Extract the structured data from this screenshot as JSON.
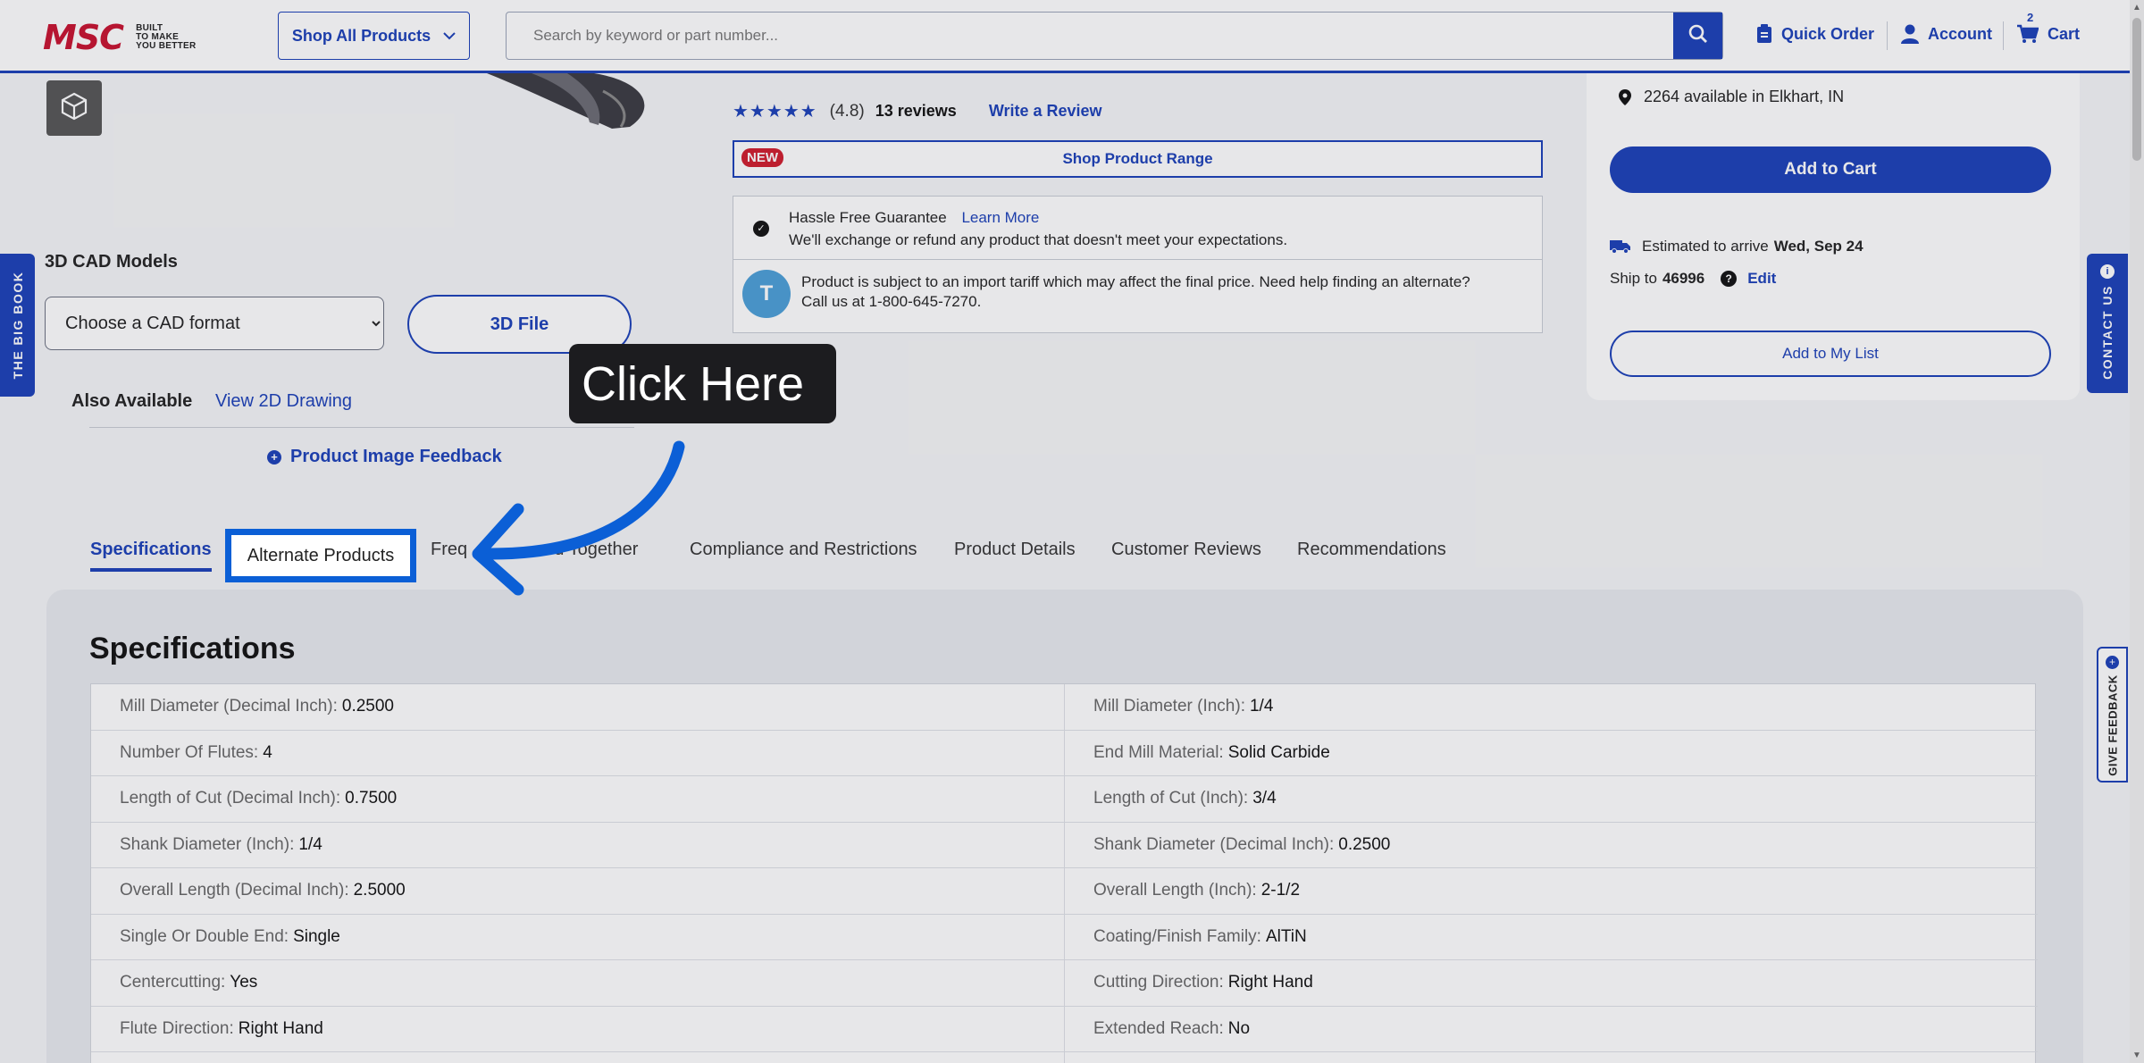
{
  "header": {
    "logo_text": "MSC",
    "logo_tagline": [
      "BUILT",
      "TO MAKE",
      "YOU BETTER"
    ],
    "shop_all_label": "Shop All Products",
    "search_placeholder": "Search by keyword or part number...",
    "quick_order_label": "Quick Order",
    "account_label": "Account",
    "cart_label": "Cart",
    "cart_count": "2"
  },
  "media": {
    "cad_title": "3D CAD Models",
    "cad_select_value": "Choose a CAD format",
    "file_button_label": "3D File",
    "also_available_label": "Also Available",
    "view_2d_label": "View 2D Drawing",
    "feedback_label": "Product Image Feedback"
  },
  "product": {
    "stars": "★★★★★",
    "rating": "(4.8)",
    "review_count": "13 reviews",
    "write_review_label": "Write a Review",
    "new_badge": "NEW",
    "shop_range_label": "Shop Product Range",
    "guarantee_title": "Hassle Free Guarantee",
    "learn_more_label": "Learn More",
    "guarantee_text": "We'll exchange or refund any product that doesn't meet your expectations.",
    "tariff_text_1": "Product is subject to an import tariff which may affect the final price. Need help finding an alternate?",
    "tariff_text_2": "Call us at 1-800-645-7270."
  },
  "buy_panel": {
    "availability": "2264 available in Elkhart, IN",
    "add_to_cart_label": "Add to Cart",
    "estimate_prefix": "Estimated to arrive",
    "estimate_date": "Wed, Sep 24",
    "ship_prefix": "Ship to",
    "ship_zip": "46996",
    "edit_label": "Edit",
    "add_to_list_label": "Add to My List"
  },
  "side_tabs": {
    "big_book": "THE BIG BOOK",
    "contact_us": "CONTACT US",
    "give_feedback": "GIVE FEEDBACK"
  },
  "tabs": [
    {
      "label": "Specifications",
      "active": true
    },
    {
      "label": "Alternate Products",
      "active": false
    },
    {
      "label": "Frequently Bought Together",
      "active": false
    },
    {
      "label": "Compliance and Restrictions",
      "active": false
    },
    {
      "label": "Product Details",
      "active": false
    },
    {
      "label": "Customer Reviews",
      "active": false
    },
    {
      "label": "Recommendations",
      "active": false
    }
  ],
  "tab_visible_fragments": {
    "freq_left": "Freq",
    "freq_right": "ed Together"
  },
  "specifications": {
    "title": "Specifications",
    "rows": [
      {
        "left_label": "Mill Diameter (Decimal Inch):",
        "left_value": "0.2500",
        "right_label": "Mill Diameter (Inch):",
        "right_value": "1/4"
      },
      {
        "left_label": "Number Of Flutes:",
        "left_value": "4",
        "right_label": "End Mill Material:",
        "right_value": "Solid Carbide"
      },
      {
        "left_label": "Length of Cut (Decimal Inch):",
        "left_value": "0.7500",
        "right_label": "Length of Cut (Inch):",
        "right_value": "3/4"
      },
      {
        "left_label": "Shank Diameter (Inch):",
        "left_value": "1/4",
        "right_label": "Shank Diameter (Decimal Inch):",
        "right_value": "0.2500"
      },
      {
        "left_label": "Overall Length (Decimal Inch):",
        "left_value": "2.5000",
        "right_label": "Overall Length (Inch):",
        "right_value": "2-1/2"
      },
      {
        "left_label": "Single Or Double End:",
        "left_value": "Single",
        "right_label": "Coating/Finish Family:",
        "right_value": "AlTiN"
      },
      {
        "left_label": "Centercutting:",
        "left_value": "Yes",
        "right_label": "Cutting Direction:",
        "right_value": "Right Hand"
      },
      {
        "left_label": "Flute Direction:",
        "left_value": "Right Hand",
        "right_label": "Extended Reach:",
        "right_value": "No"
      }
    ]
  },
  "overlay": {
    "callout_text": "Click Here",
    "highlighted_tab": "Alternate Products"
  },
  "colors": {
    "brand_blue": "#1a3fb8",
    "brand_red": "#c8102e",
    "callout_bg": "#1c1c1f",
    "highlight_border": "#0b5fd6"
  }
}
